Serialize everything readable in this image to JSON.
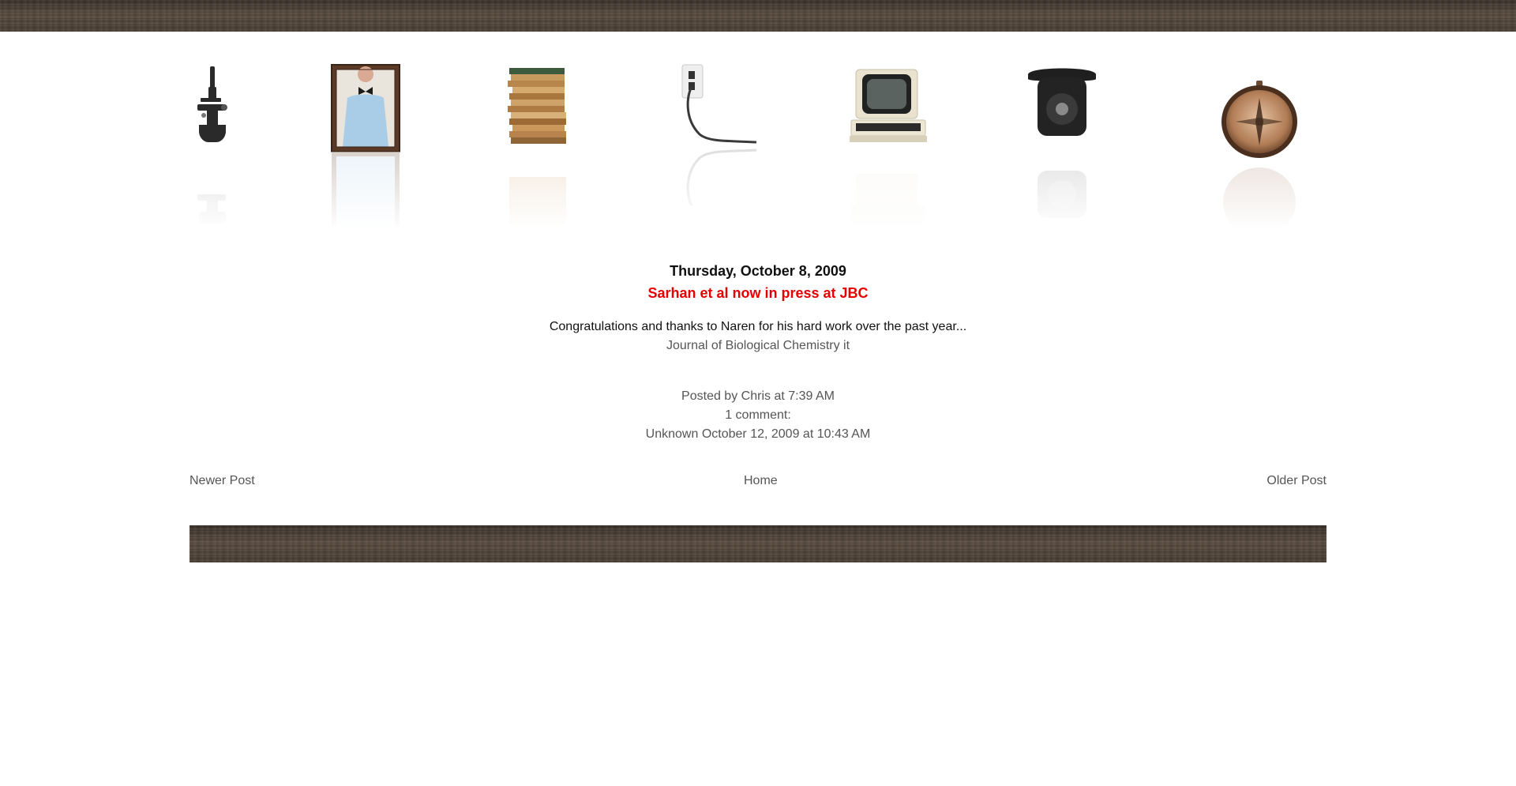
{
  "header": {
    "items": [
      {
        "name": "microscope-icon"
      },
      {
        "name": "framed-portrait-icon"
      },
      {
        "name": "paper-stack-icon"
      },
      {
        "name": "wall-outlet-icon"
      },
      {
        "name": "vintage-computer-icon"
      },
      {
        "name": "rotary-telephone-icon"
      },
      {
        "name": "compass-icon"
      }
    ]
  },
  "post": {
    "date": "Thursday, October 8, 2009",
    "title": "Sarhan et al now in press at JBC",
    "body_line1": "Congratulations and thanks to Naren for his hard work over the past year...",
    "body_line2": "Journal of Biological Chemistry it",
    "posted_by_prefix": "Posted by ",
    "author": "Chris",
    "at_word": " at ",
    "time": "7:39 AM",
    "comment_count": "1 comment:",
    "comment_author": "Unknown",
    "comment_timestamp": "October 12, 2009 at 10:43 AM"
  },
  "pager": {
    "newer": "Newer Post",
    "home": "Home",
    "older": "Older Post"
  },
  "colors": {
    "title": "#e50000",
    "wood": "#4e4236"
  }
}
